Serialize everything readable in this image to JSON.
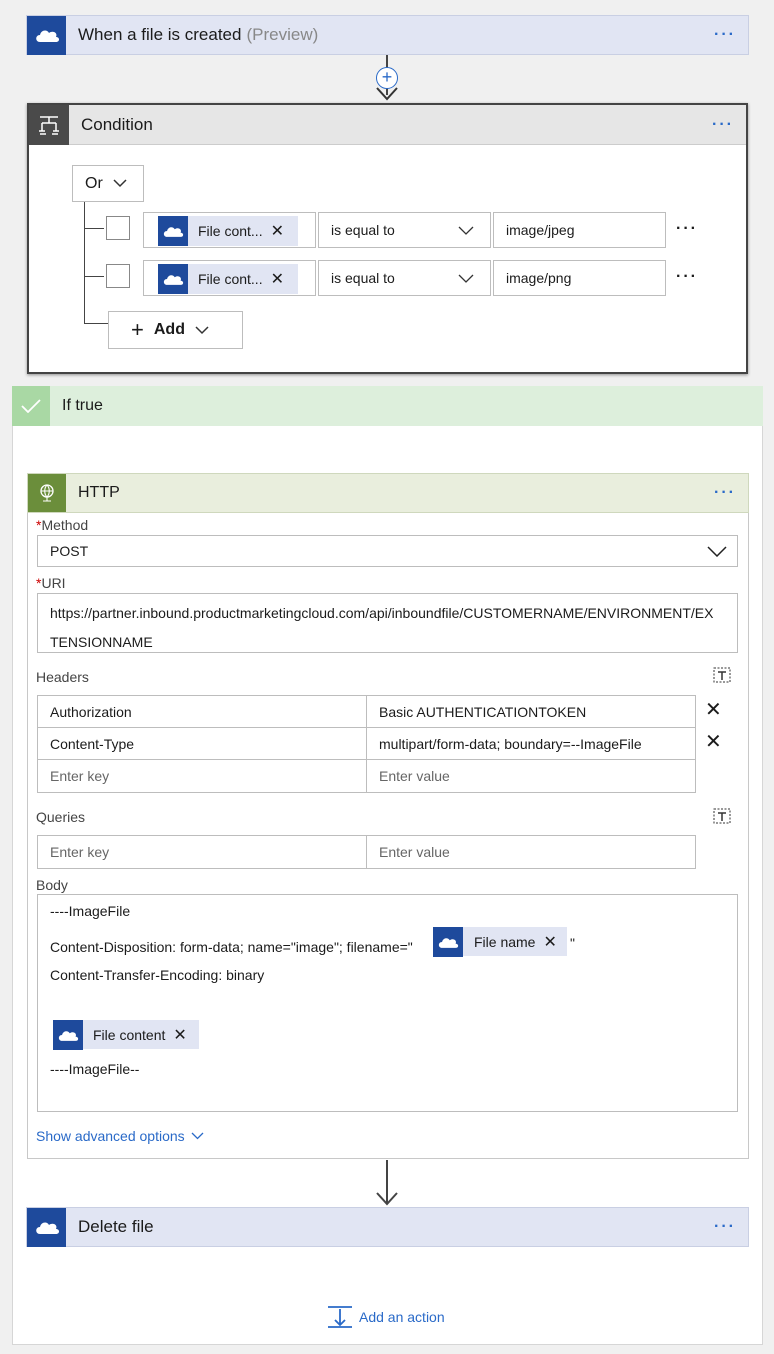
{
  "trigger": {
    "title": "When a file is created",
    "preview": "(Preview)",
    "more": "···"
  },
  "condition": {
    "title": "Condition",
    "more": "···",
    "group_op": "Or",
    "rows": [
      {
        "token": "File cont...",
        "operator": "is equal to",
        "value": "image/jpeg",
        "more": "···"
      },
      {
        "token": "File cont...",
        "operator": "is equal to",
        "value": "image/png",
        "more": "···"
      }
    ],
    "add_label": "Add"
  },
  "if_true": {
    "title": "If true"
  },
  "http": {
    "title": "HTTP",
    "more": "···",
    "method_label": "Method",
    "method_value": "POST",
    "uri_label": "URI",
    "uri_line1": "https://partner.inbound.productmarketingcloud.com/api/inboundfile/CUSTOMERNAME/ENVIRONMENT/EX",
    "uri_line2": "TENSIONNAME",
    "headers_label": "Headers",
    "headers": [
      {
        "key": "Authorization",
        "value": "Basic AUTHENTICATIONTOKEN"
      },
      {
        "key": "Content-Type",
        "value": "multipart/form-data; boundary=--ImageFile"
      }
    ],
    "key_placeholder": "Enter key",
    "value_placeholder": "Enter value",
    "queries_label": "Queries",
    "body_label": "Body",
    "body_line1": "----ImageFile",
    "body_line2": "Content-Disposition: form-data; name=\"image\"; filename=\"",
    "body_filename_token": "File name",
    "body_line2_end": "\"",
    "body_line3": "Content-Transfer-Encoding: binary",
    "body_content_token": "File content",
    "body_line5": "----ImageFile--",
    "advanced": "Show advanced options"
  },
  "delete": {
    "title": "Delete file",
    "more": "···"
  },
  "add_action": "Add an action",
  "colors": {
    "accent": "#2a6ac8",
    "onedrive": "#1e4a9c",
    "card_header": "#e1e5f3",
    "if_true": "#ddefdc",
    "http_header": "#e9eedd",
    "http_icon": "#6b8e3b"
  }
}
